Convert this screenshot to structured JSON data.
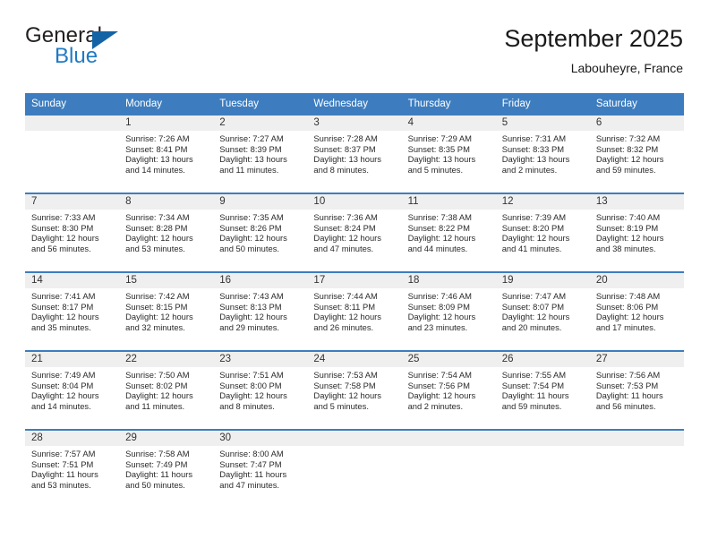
{
  "brand": {
    "word_one": "General",
    "word_two": "Blue",
    "triangle_icon": "triangle-icon",
    "accent_color": "#1464a5",
    "blue_text_color": "#1f7ac4"
  },
  "header": {
    "title": "September 2025",
    "subtitle": "Labouheyre, France"
  },
  "theme": {
    "header_blue": "#3d7dbf",
    "day_band_gray": "#efefef",
    "text_color": "#2a2a2a"
  },
  "calendar": {
    "day_headers": [
      "Sunday",
      "Monday",
      "Tuesday",
      "Wednesday",
      "Thursday",
      "Friday",
      "Saturday"
    ],
    "weeks": [
      [
        {
          "day": "",
          "sunrise": "",
          "sunset": "",
          "daylight_1": "",
          "daylight_2": "",
          "empty": true
        },
        {
          "day": "1",
          "sunrise": "Sunrise: 7:26 AM",
          "sunset": "Sunset: 8:41 PM",
          "daylight_1": "Daylight: 13 hours",
          "daylight_2": "and 14 minutes.",
          "empty": false
        },
        {
          "day": "2",
          "sunrise": "Sunrise: 7:27 AM",
          "sunset": "Sunset: 8:39 PM",
          "daylight_1": "Daylight: 13 hours",
          "daylight_2": "and 11 minutes.",
          "empty": false
        },
        {
          "day": "3",
          "sunrise": "Sunrise: 7:28 AM",
          "sunset": "Sunset: 8:37 PM",
          "daylight_1": "Daylight: 13 hours",
          "daylight_2": "and 8 minutes.",
          "empty": false
        },
        {
          "day": "4",
          "sunrise": "Sunrise: 7:29 AM",
          "sunset": "Sunset: 8:35 PM",
          "daylight_1": "Daylight: 13 hours",
          "daylight_2": "and 5 minutes.",
          "empty": false
        },
        {
          "day": "5",
          "sunrise": "Sunrise: 7:31 AM",
          "sunset": "Sunset: 8:33 PM",
          "daylight_1": "Daylight: 13 hours",
          "daylight_2": "and 2 minutes.",
          "empty": false
        },
        {
          "day": "6",
          "sunrise": "Sunrise: 7:32 AM",
          "sunset": "Sunset: 8:32 PM",
          "daylight_1": "Daylight: 12 hours",
          "daylight_2": "and 59 minutes.",
          "empty": false
        }
      ],
      [
        {
          "day": "7",
          "sunrise": "Sunrise: 7:33 AM",
          "sunset": "Sunset: 8:30 PM",
          "daylight_1": "Daylight: 12 hours",
          "daylight_2": "and 56 minutes.",
          "empty": false
        },
        {
          "day": "8",
          "sunrise": "Sunrise: 7:34 AM",
          "sunset": "Sunset: 8:28 PM",
          "daylight_1": "Daylight: 12 hours",
          "daylight_2": "and 53 minutes.",
          "empty": false
        },
        {
          "day": "9",
          "sunrise": "Sunrise: 7:35 AM",
          "sunset": "Sunset: 8:26 PM",
          "daylight_1": "Daylight: 12 hours",
          "daylight_2": "and 50 minutes.",
          "empty": false
        },
        {
          "day": "10",
          "sunrise": "Sunrise: 7:36 AM",
          "sunset": "Sunset: 8:24 PM",
          "daylight_1": "Daylight: 12 hours",
          "daylight_2": "and 47 minutes.",
          "empty": false
        },
        {
          "day": "11",
          "sunrise": "Sunrise: 7:38 AM",
          "sunset": "Sunset: 8:22 PM",
          "daylight_1": "Daylight: 12 hours",
          "daylight_2": "and 44 minutes.",
          "empty": false
        },
        {
          "day": "12",
          "sunrise": "Sunrise: 7:39 AM",
          "sunset": "Sunset: 8:20 PM",
          "daylight_1": "Daylight: 12 hours",
          "daylight_2": "and 41 minutes.",
          "empty": false
        },
        {
          "day": "13",
          "sunrise": "Sunrise: 7:40 AM",
          "sunset": "Sunset: 8:19 PM",
          "daylight_1": "Daylight: 12 hours",
          "daylight_2": "and 38 minutes.",
          "empty": false
        }
      ],
      [
        {
          "day": "14",
          "sunrise": "Sunrise: 7:41 AM",
          "sunset": "Sunset: 8:17 PM",
          "daylight_1": "Daylight: 12 hours",
          "daylight_2": "and 35 minutes.",
          "empty": false
        },
        {
          "day": "15",
          "sunrise": "Sunrise: 7:42 AM",
          "sunset": "Sunset: 8:15 PM",
          "daylight_1": "Daylight: 12 hours",
          "daylight_2": "and 32 minutes.",
          "empty": false
        },
        {
          "day": "16",
          "sunrise": "Sunrise: 7:43 AM",
          "sunset": "Sunset: 8:13 PM",
          "daylight_1": "Daylight: 12 hours",
          "daylight_2": "and 29 minutes.",
          "empty": false
        },
        {
          "day": "17",
          "sunrise": "Sunrise: 7:44 AM",
          "sunset": "Sunset: 8:11 PM",
          "daylight_1": "Daylight: 12 hours",
          "daylight_2": "and 26 minutes.",
          "empty": false
        },
        {
          "day": "18",
          "sunrise": "Sunrise: 7:46 AM",
          "sunset": "Sunset: 8:09 PM",
          "daylight_1": "Daylight: 12 hours",
          "daylight_2": "and 23 minutes.",
          "empty": false
        },
        {
          "day": "19",
          "sunrise": "Sunrise: 7:47 AM",
          "sunset": "Sunset: 8:07 PM",
          "daylight_1": "Daylight: 12 hours",
          "daylight_2": "and 20 minutes.",
          "empty": false
        },
        {
          "day": "20",
          "sunrise": "Sunrise: 7:48 AM",
          "sunset": "Sunset: 8:06 PM",
          "daylight_1": "Daylight: 12 hours",
          "daylight_2": "and 17 minutes.",
          "empty": false
        }
      ],
      [
        {
          "day": "21",
          "sunrise": "Sunrise: 7:49 AM",
          "sunset": "Sunset: 8:04 PM",
          "daylight_1": "Daylight: 12 hours",
          "daylight_2": "and 14 minutes.",
          "empty": false
        },
        {
          "day": "22",
          "sunrise": "Sunrise: 7:50 AM",
          "sunset": "Sunset: 8:02 PM",
          "daylight_1": "Daylight: 12 hours",
          "daylight_2": "and 11 minutes.",
          "empty": false
        },
        {
          "day": "23",
          "sunrise": "Sunrise: 7:51 AM",
          "sunset": "Sunset: 8:00 PM",
          "daylight_1": "Daylight: 12 hours",
          "daylight_2": "and 8 minutes.",
          "empty": false
        },
        {
          "day": "24",
          "sunrise": "Sunrise: 7:53 AM",
          "sunset": "Sunset: 7:58 PM",
          "daylight_1": "Daylight: 12 hours",
          "daylight_2": "and 5 minutes.",
          "empty": false
        },
        {
          "day": "25",
          "sunrise": "Sunrise: 7:54 AM",
          "sunset": "Sunset: 7:56 PM",
          "daylight_1": "Daylight: 12 hours",
          "daylight_2": "and 2 minutes.",
          "empty": false
        },
        {
          "day": "26",
          "sunrise": "Sunrise: 7:55 AM",
          "sunset": "Sunset: 7:54 PM",
          "daylight_1": "Daylight: 11 hours",
          "daylight_2": "and 59 minutes.",
          "empty": false
        },
        {
          "day": "27",
          "sunrise": "Sunrise: 7:56 AM",
          "sunset": "Sunset: 7:53 PM",
          "daylight_1": "Daylight: 11 hours",
          "daylight_2": "and 56 minutes.",
          "empty": false
        }
      ],
      [
        {
          "day": "28",
          "sunrise": "Sunrise: 7:57 AM",
          "sunset": "Sunset: 7:51 PM",
          "daylight_1": "Daylight: 11 hours",
          "daylight_2": "and 53 minutes.",
          "empty": false
        },
        {
          "day": "29",
          "sunrise": "Sunrise: 7:58 AM",
          "sunset": "Sunset: 7:49 PM",
          "daylight_1": "Daylight: 11 hours",
          "daylight_2": "and 50 minutes.",
          "empty": false
        },
        {
          "day": "30",
          "sunrise": "Sunrise: 8:00 AM",
          "sunset": "Sunset: 7:47 PM",
          "daylight_1": "Daylight: 11 hours",
          "daylight_2": "and 47 minutes.",
          "empty": false
        },
        {
          "day": "",
          "sunrise": "",
          "sunset": "",
          "daylight_1": "",
          "daylight_2": "",
          "empty": true
        },
        {
          "day": "",
          "sunrise": "",
          "sunset": "",
          "daylight_1": "",
          "daylight_2": "",
          "empty": true
        },
        {
          "day": "",
          "sunrise": "",
          "sunset": "",
          "daylight_1": "",
          "daylight_2": "",
          "empty": true
        },
        {
          "day": "",
          "sunrise": "",
          "sunset": "",
          "daylight_1": "",
          "daylight_2": "",
          "empty": true
        }
      ]
    ]
  }
}
